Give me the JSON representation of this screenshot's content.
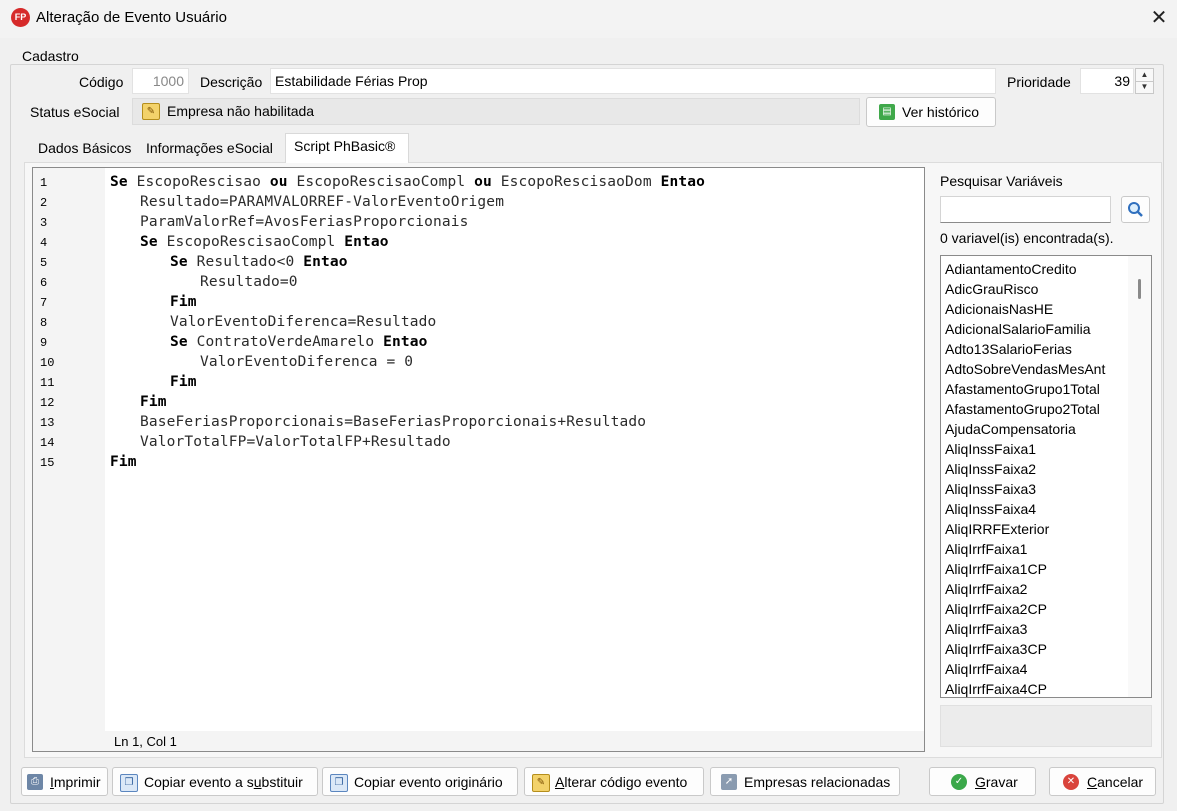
{
  "window": {
    "title": "Alteração de Evento Usuário",
    "logo_text": "FP",
    "close_glyph": "✕"
  },
  "cadastro": {
    "legend": "Cadastro",
    "codigo_label": "Código",
    "codigo_value": "1000",
    "descricao_label": "Descrição",
    "descricao_value": "Estabilidade Férias Prop",
    "prioridade_label": "Prioridade",
    "prioridade_value": "39",
    "status_label": "Status eSocial",
    "status_value": "Empresa não habilitada",
    "ver_historico_label": "Ver histórico"
  },
  "tabs": [
    {
      "label": "Dados Básicos"
    },
    {
      "label": "Informações eSocial"
    },
    {
      "label": "Script PhBasic®",
      "active": true
    }
  ],
  "editor": {
    "cursor_position": "Ln 1, Col 1",
    "lines": [
      {
        "n": "1",
        "indent": 0,
        "tokens": [
          [
            "kw",
            "Se"
          ],
          [
            "",
            " EscopoRescisao "
          ],
          [
            "kw",
            "ou"
          ],
          [
            "",
            " EscopoRescisaoCompl "
          ],
          [
            "kw",
            "ou"
          ],
          [
            "",
            " EscopoRescisaoDom "
          ],
          [
            "kw",
            "Entao"
          ]
        ]
      },
      {
        "n": "2",
        "indent": 1,
        "tokens": [
          [
            "",
            "Resultado=PARAMVALORREF-ValorEventoOrigem"
          ]
        ]
      },
      {
        "n": "3",
        "indent": 1,
        "tokens": [
          [
            "",
            "ParamValorRef=AvosFeriasProporcionais"
          ]
        ]
      },
      {
        "n": "4",
        "indent": 1,
        "tokens": [
          [
            "kw",
            "Se"
          ],
          [
            "",
            " EscopoRescisaoCompl "
          ],
          [
            "kw",
            "Entao"
          ]
        ]
      },
      {
        "n": "5",
        "indent": 2,
        "tokens": [
          [
            "kw",
            "Se"
          ],
          [
            "",
            " Resultado<0 "
          ],
          [
            "kw",
            "Entao"
          ]
        ]
      },
      {
        "n": "6",
        "indent": 3,
        "tokens": [
          [
            "",
            "Resultado=0"
          ]
        ]
      },
      {
        "n": "7",
        "indent": 2,
        "tokens": [
          [
            "kw",
            "Fim"
          ]
        ]
      },
      {
        "n": "8",
        "indent": 2,
        "tokens": [
          [
            "",
            "ValorEventoDiferenca=Resultado"
          ]
        ]
      },
      {
        "n": "9",
        "indent": 2,
        "tokens": [
          [
            "kw",
            "Se"
          ],
          [
            "",
            " ContratoVerdeAmarelo "
          ],
          [
            "kw",
            "Entao"
          ]
        ]
      },
      {
        "n": "10",
        "indent": 3,
        "tokens": [
          [
            "",
            "ValorEventoDiferenca = 0"
          ]
        ]
      },
      {
        "n": "11",
        "indent": 2,
        "tokens": [
          [
            "kw",
            "Fim"
          ]
        ]
      },
      {
        "n": "12",
        "indent": 1,
        "tokens": [
          [
            "kw",
            "Fim"
          ]
        ]
      },
      {
        "n": "13",
        "indent": 1,
        "tokens": [
          [
            "",
            "BaseFeriasProporcionais=BaseFeriasProporcionais+Resultado"
          ]
        ]
      },
      {
        "n": "14",
        "indent": 1,
        "tokens": [
          [
            "",
            "ValorTotalFP=ValorTotalFP+Resultado"
          ]
        ]
      },
      {
        "n": "15",
        "indent": 0,
        "tokens": [
          [
            "kw",
            "Fim"
          ]
        ]
      }
    ]
  },
  "variables": {
    "search_label": "Pesquisar Variáveis",
    "search_value": "",
    "count_text": "0 variavel(is) encontrada(s).",
    "items": [
      "AdiantamentoCredito",
      "AdicGrauRisco",
      "AdicionaisNasHE",
      "AdicionalSalarioFamilia",
      "Adto13SalarioFerias",
      "AdtoSobreVendasMesAnt",
      "AfastamentoGrupo1Total",
      "AfastamentoGrupo2Total",
      "AjudaCompensatoria",
      "AliqInssFaixa1",
      "AliqInssFaixa2",
      "AliqInssFaixa3",
      "AliqInssFaixa4",
      "AliqIRRFExterior",
      "AliqIrrfFaixa1",
      "AliqIrrfFaixa1CP",
      "AliqIrrfFaixa2",
      "AliqIrrfFaixa2CP",
      "AliqIrrfFaixa3",
      "AliqIrrfFaixa3CP",
      "AliqIrrfFaixa4",
      "AliqIrrfFaixa4CP"
    ]
  },
  "buttons": {
    "imprimir": {
      "pre": "",
      "u": "I",
      "post": "mprimir"
    },
    "copiar_sub": {
      "pre": "Copiar evento a s",
      "u": "u",
      "post": "bstituir"
    },
    "copiar_orig": {
      "pre": "Copiar evento originário",
      "u": "",
      "post": ""
    },
    "alterar": {
      "pre": "",
      "u": "A",
      "post": "lterar código evento"
    },
    "empresas": {
      "pre": "Empresas relacionadas",
      "u": "",
      "post": ""
    },
    "gravar": {
      "pre": "",
      "u": "G",
      "post": "ravar"
    },
    "cancelar": {
      "pre": "",
      "u": "C",
      "post": "ancelar"
    }
  }
}
